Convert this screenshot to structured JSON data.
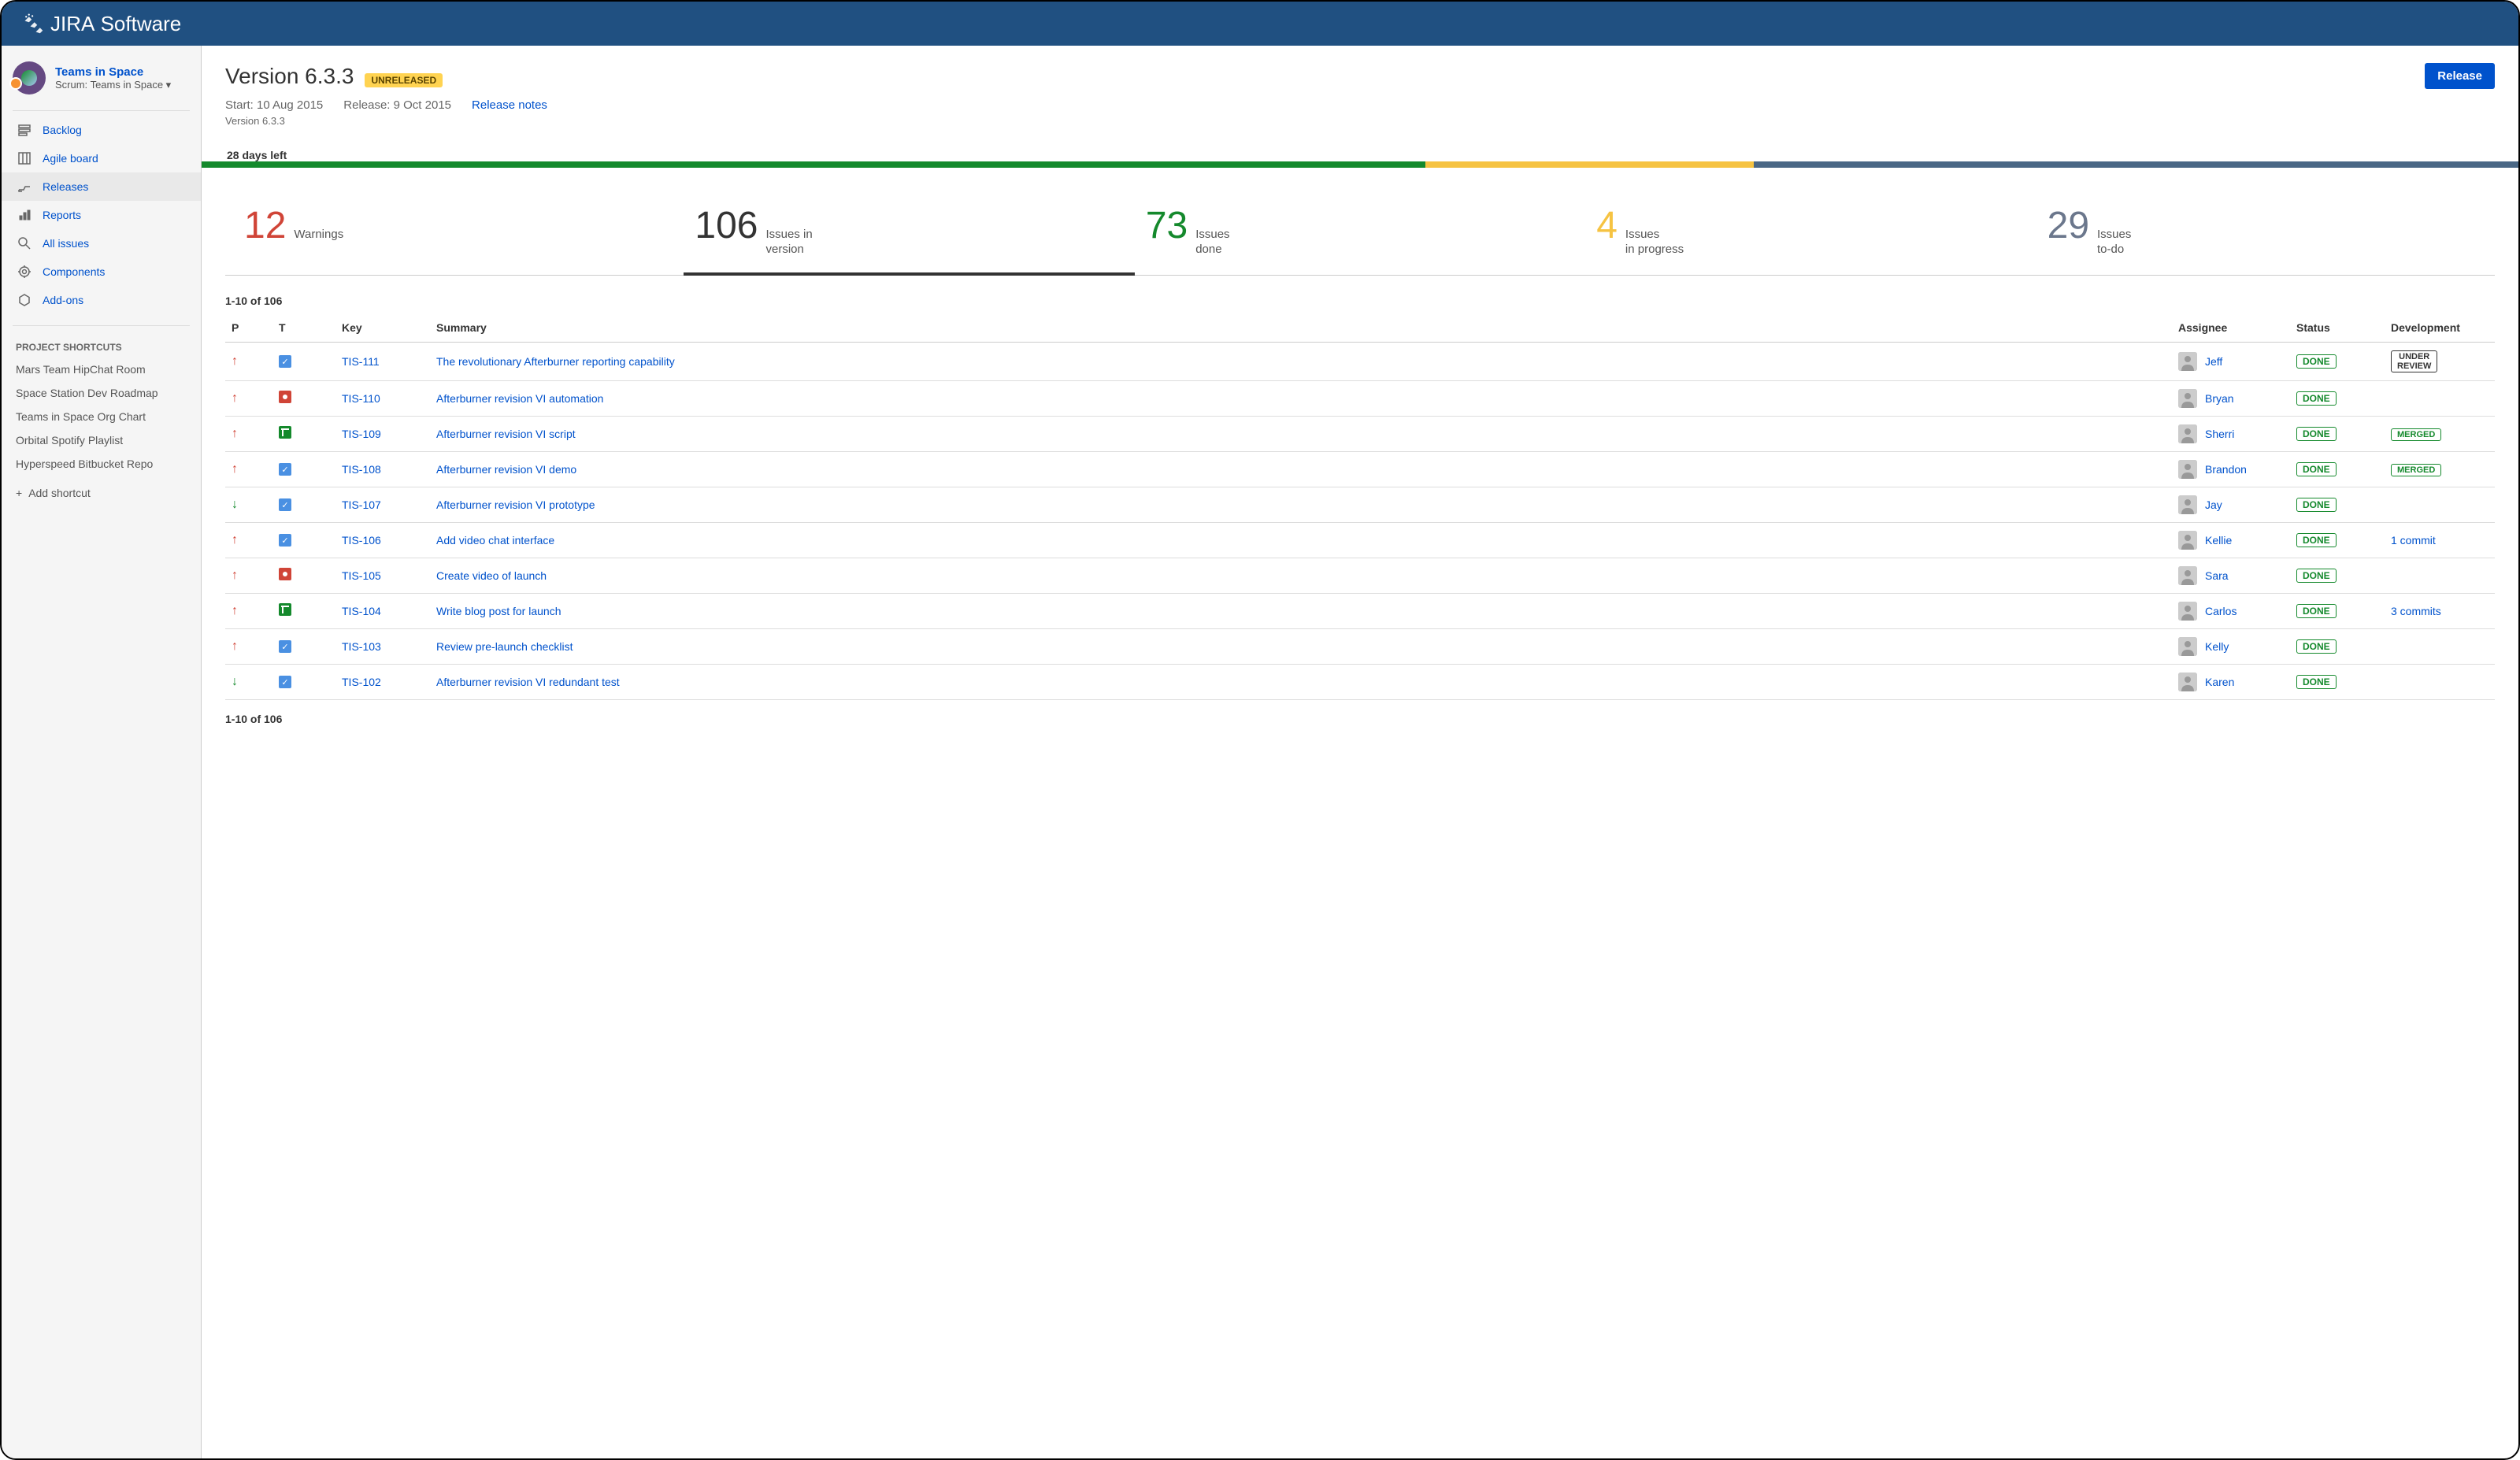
{
  "logo_brand": "JIRA",
  "logo_suffix": "Software",
  "project": {
    "name": "Teams in Space",
    "type_prefix": "Scrum: ",
    "type": "Teams in Space"
  },
  "nav": [
    {
      "id": "backlog",
      "label": "Backlog",
      "icon": "backlog"
    },
    {
      "id": "agile",
      "label": "Agile board",
      "icon": "board"
    },
    {
      "id": "releases",
      "label": "Releases",
      "icon": "releases",
      "active": true
    },
    {
      "id": "reports",
      "label": "Reports",
      "icon": "reports"
    },
    {
      "id": "all-issues",
      "label": "All issues",
      "icon": "search"
    },
    {
      "id": "components",
      "label": "Components",
      "icon": "components"
    },
    {
      "id": "addons",
      "label": "Add-ons",
      "icon": "addons"
    }
  ],
  "shortcuts_title": "PROJECT SHORTCUTS",
  "shortcuts": [
    "Mars Team HipChat Room",
    "Space Station Dev Roadmap",
    "Teams in Space Org Chart",
    "Orbital Spotify Playlist",
    "Hyperspeed Bitbucket Repo"
  ],
  "add_shortcut": "Add shortcut",
  "version": {
    "title": "Version 6.3.3",
    "badge": "UNRELEASED",
    "start": "Start: 10 Aug 2015",
    "release": "Release: 9 Oct 2015",
    "notes": "Release notes",
    "breadcrumb": "Version 6.3.3",
    "days_left": "28 days left",
    "release_button": "Release"
  },
  "stats": [
    {
      "n": "12",
      "label": "Warnings",
      "color": "c-red"
    },
    {
      "n": "106",
      "label": "Issues in\nversion",
      "color": "c-dark",
      "active": true
    },
    {
      "n": "73",
      "label": "Issues\ndone",
      "color": "c-green"
    },
    {
      "n": "4",
      "label": "Issues\nin progress",
      "color": "c-yellow"
    },
    {
      "n": "29",
      "label": "Issues\nto-do",
      "color": "c-grey"
    }
  ],
  "pager": "1-10 of 106",
  "table": {
    "headers": {
      "p": "P",
      "t": "T",
      "key": "Key",
      "summary": "Summary",
      "assignee": "Assignee",
      "status": "Status",
      "dev": "Development"
    },
    "rows": [
      {
        "pri": "up",
        "type": "task",
        "key": "TIS-111",
        "summary": "The revolutionary Afterburner reporting capability",
        "assignee": "Jeff",
        "status": "DONE",
        "dev": "UNDER\nREVIEW",
        "devtype": "under"
      },
      {
        "pri": "up",
        "type": "bug",
        "key": "TIS-110",
        "summary": "Afterburner revision VI automation",
        "assignee": "Bryan",
        "status": "DONE",
        "dev": ""
      },
      {
        "pri": "up",
        "type": "story",
        "key": "TIS-109",
        "summary": "Afterburner revision VI script",
        "assignee": "Sherri",
        "status": "DONE",
        "dev": "MERGED",
        "devtype": "merged"
      },
      {
        "pri": "up",
        "type": "task",
        "key": "TIS-108",
        "summary": "Afterburner revision VI demo",
        "assignee": "Brandon",
        "status": "DONE",
        "dev": "MERGED",
        "devtype": "merged"
      },
      {
        "pri": "down",
        "type": "task",
        "key": "TIS-107",
        "summary": "Afterburner revision VI prototype",
        "assignee": "Jay",
        "status": "DONE",
        "dev": ""
      },
      {
        "pri": "up",
        "type": "task",
        "key": "TIS-106",
        "summary": "Add video chat interface",
        "assignee": "Kellie",
        "status": "DONE",
        "dev": "1 commit",
        "devtype": "link"
      },
      {
        "pri": "up",
        "type": "bug",
        "key": "TIS-105",
        "summary": "Create video of launch",
        "assignee": "Sara",
        "status": "DONE",
        "dev": ""
      },
      {
        "pri": "up",
        "type": "story",
        "key": "TIS-104",
        "summary": "Write blog post for launch",
        "assignee": "Carlos",
        "status": "DONE",
        "dev": "3 commits",
        "devtype": "link"
      },
      {
        "pri": "up",
        "type": "task",
        "key": "TIS-103",
        "summary": "Review pre-launch checklist",
        "assignee": "Kelly",
        "status": "DONE",
        "dev": ""
      },
      {
        "pri": "down",
        "type": "task",
        "key": "TIS-102",
        "summary": "Afterburner revision VI redundant test",
        "assignee": "Karen",
        "status": "DONE",
        "dev": ""
      }
    ]
  }
}
